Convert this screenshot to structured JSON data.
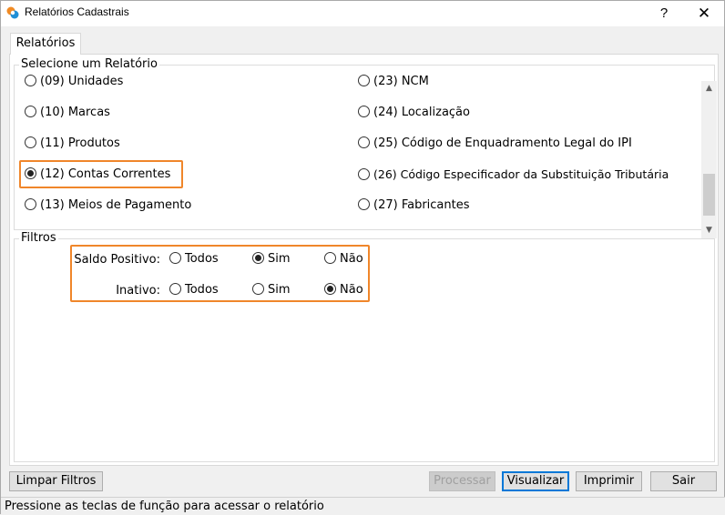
{
  "window": {
    "title": "Relatórios Cadastrais",
    "help_label": "?",
    "close_label": "✕"
  },
  "tabs": [
    {
      "label": "Relatórios",
      "active": true
    }
  ],
  "report_group": {
    "legend": "Selecione um Relatório",
    "left_items": [
      {
        "label": "(09) Unidades",
        "checked": false
      },
      {
        "label": "(10) Marcas",
        "checked": false
      },
      {
        "label": "(11) Produtos",
        "checked": false
      },
      {
        "label": "(12) Contas Correntes",
        "checked": true
      },
      {
        "label": "(13) Meios de Pagamento",
        "checked": false
      }
    ],
    "right_items": [
      {
        "label": "(23) NCM",
        "checked": false
      },
      {
        "label": "(24) Localização",
        "checked": false
      },
      {
        "label": "(25) Código de Enquadramento Legal do IPI",
        "checked": false
      },
      {
        "label": "(26) Código Especificador da Substituição Tributária",
        "checked": false
      },
      {
        "label": "(27) Fabricantes",
        "checked": false
      }
    ]
  },
  "filters": {
    "legend": "Filtros",
    "saldo_positivo": {
      "label": "Saldo Positivo:",
      "options": [
        "Todos",
        "Sim",
        "Não"
      ],
      "selected": "Sim"
    },
    "inativo": {
      "label": "Inativo:",
      "options": [
        "Todos",
        "Sim",
        "Não"
      ],
      "selected": "Não"
    }
  },
  "buttons": {
    "limpar_filtros": "Limpar Filtros",
    "processar": "Processar",
    "visualizar": "Visualizar",
    "imprimir": "Imprimir",
    "sair": "Sair"
  },
  "status": "Pressione as teclas de função para acessar o relatório",
  "colors": {
    "highlight": "#f0862a",
    "default_button_border": "#0078d7"
  }
}
